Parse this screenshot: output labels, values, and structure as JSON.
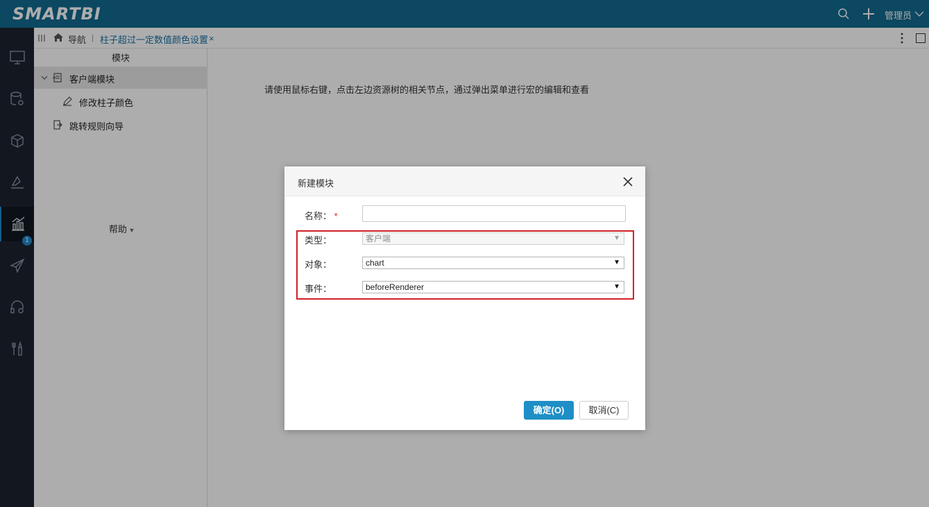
{
  "header": {
    "logo": "SMARTBI",
    "user": "管理员",
    "icons": [
      "search-icon",
      "plus-icon",
      "chevron-down-icon"
    ]
  },
  "leftnav": {
    "items": [
      {
        "icon": "monitor-icon"
      },
      {
        "icon": "database-settings-icon"
      },
      {
        "icon": "cube-icon"
      },
      {
        "icon": "pen-ruler-icon"
      },
      {
        "icon": "bar-chart-icon",
        "badge": "1",
        "active": true
      },
      {
        "icon": "paper-plane-icon"
      },
      {
        "icon": "headset-icon"
      },
      {
        "icon": "tools-icon"
      }
    ]
  },
  "breadcrumb": {
    "nav": "导航",
    "separator": "|",
    "tab": "柱子超过一定数值颜色设置",
    "close": "×"
  },
  "tree": {
    "header": "模块",
    "items": [
      {
        "label": "客户端模块",
        "selected": true
      },
      {
        "label": "修改柱子颜色"
      },
      {
        "label": "跳转规则向导"
      }
    ],
    "help": "帮助"
  },
  "content": {
    "hint": "请使用鼠标右键，点击左边资源树的相关节点，通过弹出菜单进行宏的编辑和查看"
  },
  "dialog": {
    "title": "新建模块",
    "name_label": "名称：",
    "required_mark": "*",
    "name_value": "",
    "type_label": "类型：",
    "type_value": "客户端",
    "object_label": "对象：",
    "object_value": "chart",
    "event_label": "事件：",
    "event_value": "beforeRenderer",
    "ok_label": "确定(O)",
    "cancel_label": "取消(C)"
  },
  "colors": {
    "header_bg": "#136a90",
    "nav_bg": "#1c2430",
    "accent": "#1e8fc6",
    "highlight_box": "#d0212a"
  }
}
